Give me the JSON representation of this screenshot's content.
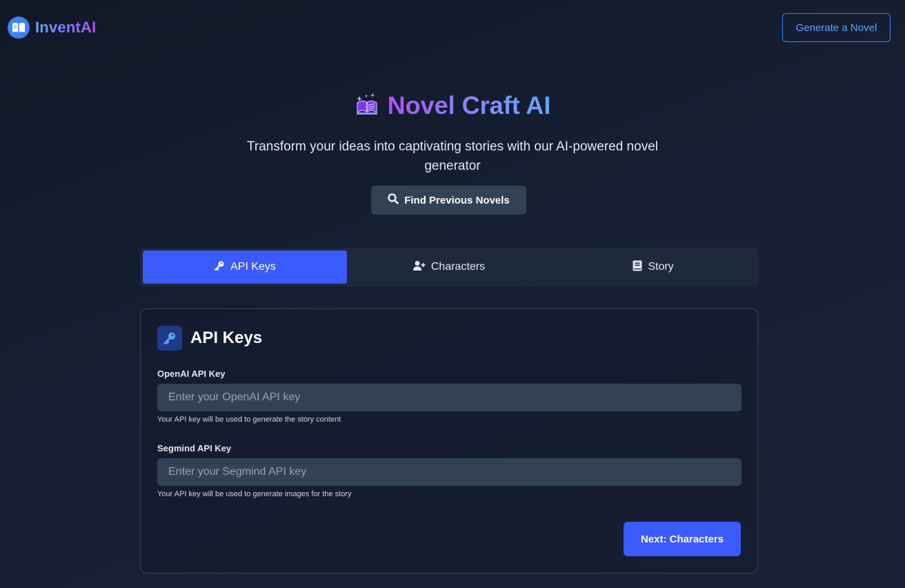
{
  "nav": {
    "brand_name": "InventAI",
    "brand_icon": "open-book-icon",
    "generate_button_label": "Generate a Novel"
  },
  "hero": {
    "title": "Novel Craft AI",
    "title_icon": "magic-book-icon",
    "subtitle": "Transform your ideas into captivating stories with our AI-powered novel generator",
    "find_button_label": "Find Previous Novels",
    "find_button_icon": "search-icon"
  },
  "tabs": [
    {
      "label": "API Keys",
      "icon": "key-icon",
      "active": true
    },
    {
      "label": "Characters",
      "icon": "user-plus-icon",
      "active": false
    },
    {
      "label": "Story",
      "icon": "book-icon",
      "active": false
    }
  ],
  "card": {
    "title": "API Keys",
    "icon": "key-icon",
    "fields": [
      {
        "label": "OpenAI API Key",
        "value": "",
        "placeholder": "Enter your OpenAI API key",
        "help": "Your API key will be used to generate the story content"
      },
      {
        "label": "Segmind API Key",
        "value": "",
        "placeholder": "Enter your Segmind API key",
        "help": "Your API key will be used to generate images for the story"
      }
    ],
    "next_button_label": "Next: Characters"
  },
  "colors": {
    "accent": "#3b5bfc",
    "brand_blue": "#60a5fa",
    "brand_purple": "#a855f7",
    "background": "#111827"
  }
}
